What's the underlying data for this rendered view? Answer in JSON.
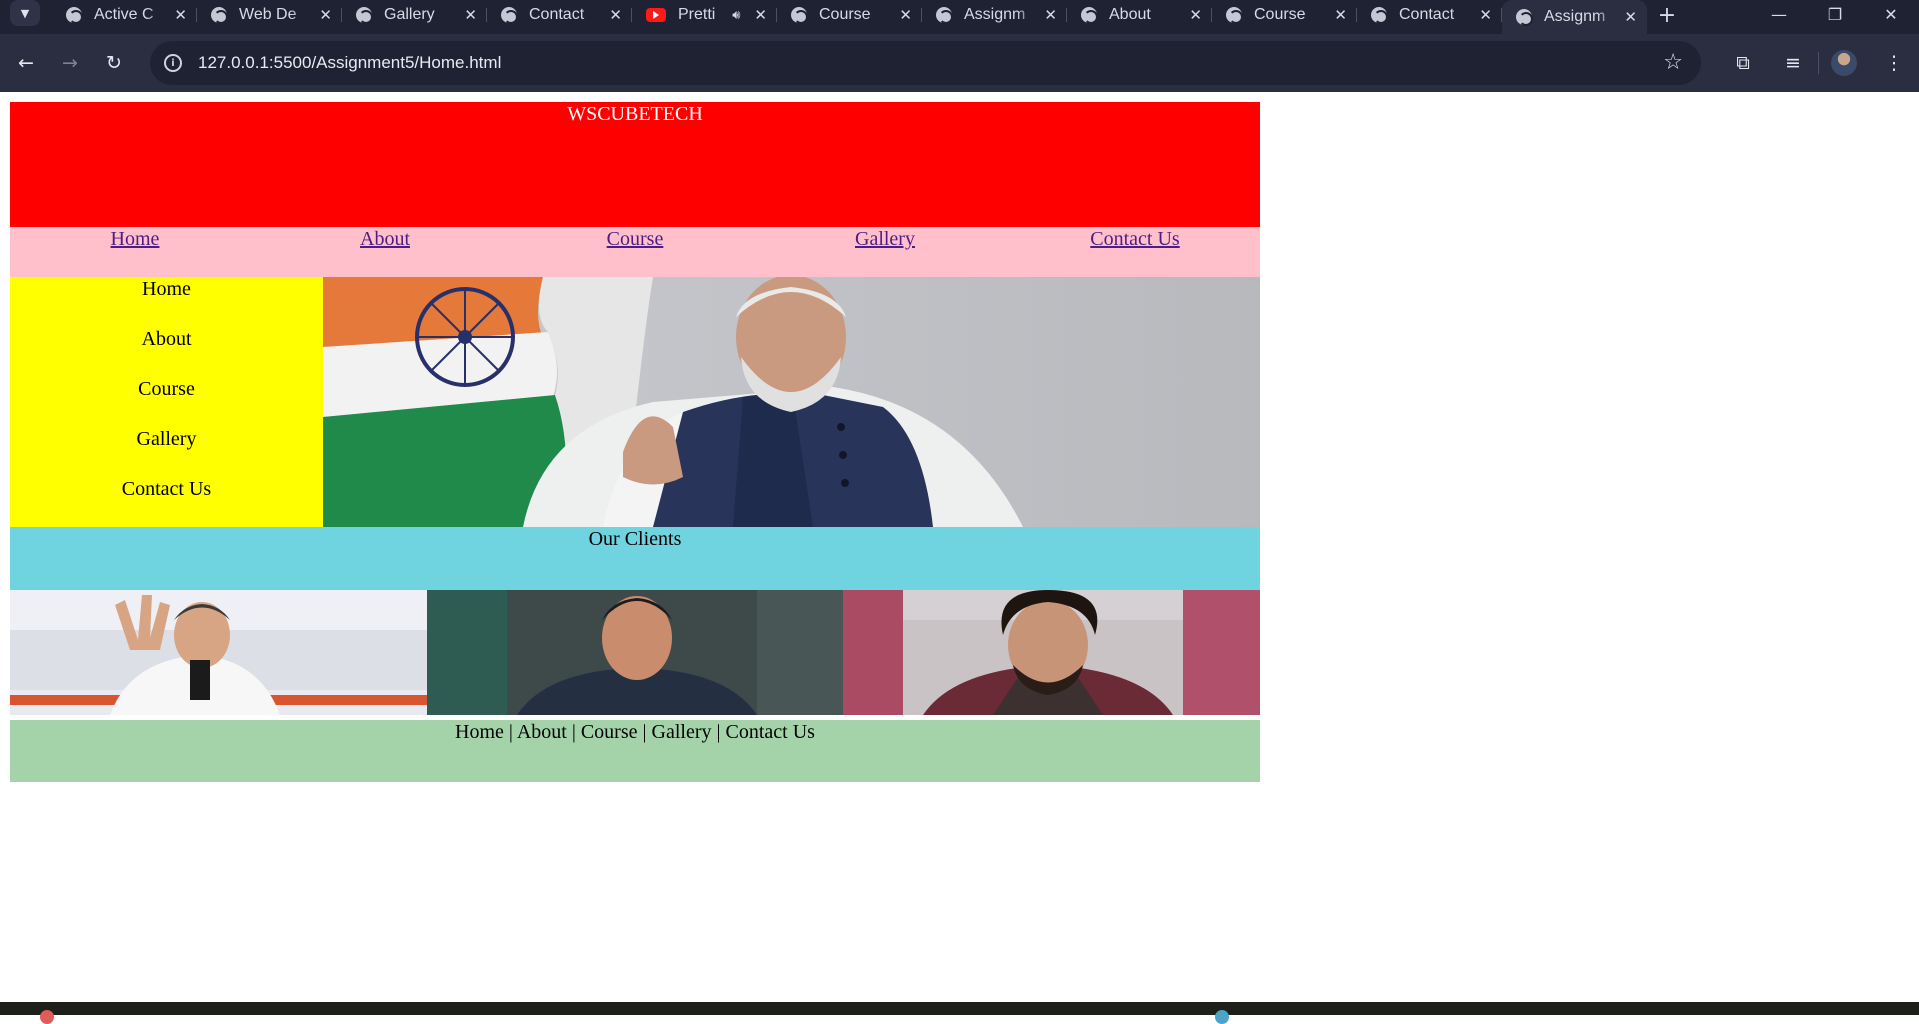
{
  "browser": {
    "tabs": [
      {
        "label": "Active C",
        "icon": "globe-icon"
      },
      {
        "label": "Web De",
        "icon": "globe-icon"
      },
      {
        "label": "Gallery",
        "icon": "globe-icon"
      },
      {
        "label": "Contact",
        "icon": "globe-icon"
      },
      {
        "label": "Pretti",
        "icon": "youtube-icon"
      },
      {
        "label": "Course",
        "icon": "globe-icon"
      },
      {
        "label": "Assignm",
        "icon": "globe-icon"
      },
      {
        "label": "About",
        "icon": "globe-icon"
      },
      {
        "label": "Course",
        "icon": "globe-icon"
      },
      {
        "label": "Contact",
        "icon": "globe-icon"
      },
      {
        "label": "Assignm",
        "icon": "globe-icon"
      }
    ],
    "url": "127.0.0.1:5500/Assignment5/Home.html"
  },
  "site": {
    "brand": "WSCUBETECH",
    "menu": [
      "Home",
      "About",
      "Course",
      "Gallery",
      "Contact Us"
    ],
    "sidebar": [
      "Home",
      "About",
      "Course",
      "Gallery",
      "Contact Us"
    ],
    "clients_heading": "Our Clients",
    "footer_links": [
      "Home",
      "About",
      "Course",
      "Gallery",
      "Contact Us"
    ],
    "footer_separator": "|"
  },
  "colors": {
    "header": "#ff0000",
    "menu": "#ffc0cb",
    "sidebar": "#ffff00",
    "clients_bar": "#70d3e0",
    "footer": "#a5d3a9"
  }
}
